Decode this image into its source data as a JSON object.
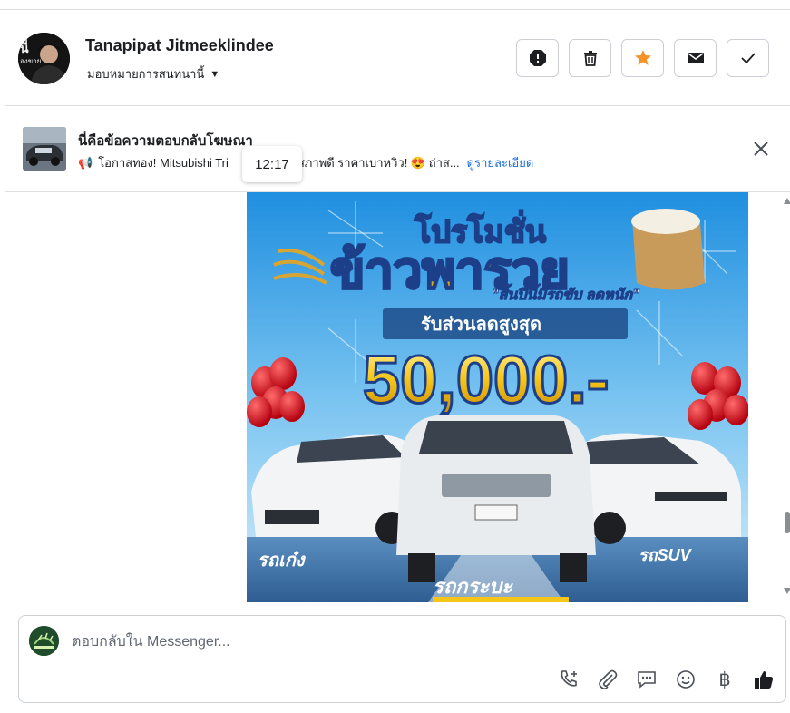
{
  "header": {
    "contact_name": "Tanapipat Jitmeeklindee",
    "assign_label": "มอบหมายการสนทนานี้"
  },
  "toolbar": {
    "buttons": [
      "spam-icon",
      "trash-icon",
      "star-icon",
      "mail-icon",
      "check-icon"
    ]
  },
  "ad_reply": {
    "title": "นี่คือข้อความตอบกลับโฆษณา",
    "snippet": "โอกาสทอง! Mitsubishi Tri",
    "snippet_after": ") สภาพดี ราคาเบาหวิว! 😍 ถ่าส...",
    "details_link": "ดูรายละเอียด"
  },
  "tooltip": {
    "time": "12:17"
  },
  "promo": {
    "headline": "โปรโมชั่น",
    "headline2": "ข้าวพารวย",
    "tagline": "\"สิ้นปีนี้มีรถขับ ลดหนัก\"",
    "discount_label": "รับส่วนลดสูงสุด",
    "discount_value": "50,000.-",
    "label_sedan": "รถเก๋ง",
    "label_pickup": "รถกระบะ",
    "label_suv": "รถSUV"
  },
  "composer": {
    "placeholder": "ตอบกลับใน Messenger...",
    "icons": [
      "call-add-icon",
      "attachment-icon",
      "saved-reply-icon",
      "emoji-icon",
      "payment-icon",
      "like-icon"
    ],
    "currency_symbol": "฿"
  },
  "colors": {
    "star": "#f7922a",
    "link": "#1d6fd6",
    "border": "#ccd0d5",
    "promo_sky": "#2f9ee8",
    "promo_gold": "#f5c518"
  }
}
